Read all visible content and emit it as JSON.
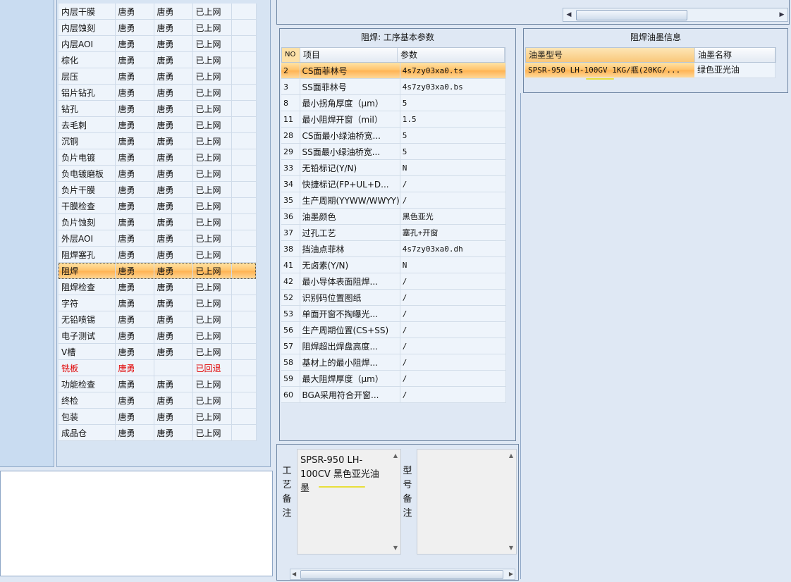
{
  "process_list": [
    {
      "name": "内层干膜",
      "col2": "唐勇",
      "col3": "唐勇",
      "status": "已上网",
      "state": "normal"
    },
    {
      "name": "内层蚀刻",
      "col2": "唐勇",
      "col3": "唐勇",
      "status": "已上网",
      "state": "normal"
    },
    {
      "name": "内层AOI",
      "col2": "唐勇",
      "col3": "唐勇",
      "status": "已上网",
      "state": "normal"
    },
    {
      "name": "棕化",
      "col2": "唐勇",
      "col3": "唐勇",
      "status": "已上网",
      "state": "normal"
    },
    {
      "name": "层压",
      "col2": "唐勇",
      "col3": "唐勇",
      "status": "已上网",
      "state": "normal"
    },
    {
      "name": "铝片钻孔",
      "col2": "唐勇",
      "col3": "唐勇",
      "status": "已上网",
      "state": "normal"
    },
    {
      "name": "钻孔",
      "col2": "唐勇",
      "col3": "唐勇",
      "status": "已上网",
      "state": "normal"
    },
    {
      "name": "去毛刺",
      "col2": "唐勇",
      "col3": "唐勇",
      "status": "已上网",
      "state": "normal"
    },
    {
      "name": "沉铜",
      "col2": "唐勇",
      "col3": "唐勇",
      "status": "已上网",
      "state": "normal"
    },
    {
      "name": "负片电镀",
      "col2": "唐勇",
      "col3": "唐勇",
      "status": "已上网",
      "state": "normal"
    },
    {
      "name": "负电镀磨板",
      "col2": "唐勇",
      "col3": "唐勇",
      "status": "已上网",
      "state": "normal"
    },
    {
      "name": "负片干膜",
      "col2": "唐勇",
      "col3": "唐勇",
      "status": "已上网",
      "state": "normal"
    },
    {
      "name": "干膜检查",
      "col2": "唐勇",
      "col3": "唐勇",
      "status": "已上网",
      "state": "normal"
    },
    {
      "name": "负片蚀刻",
      "col2": "唐勇",
      "col3": "唐勇",
      "status": "已上网",
      "state": "normal"
    },
    {
      "name": "外层AOI",
      "col2": "唐勇",
      "col3": "唐勇",
      "status": "已上网",
      "state": "normal"
    },
    {
      "name": "阻焊塞孔",
      "col2": "唐勇",
      "col3": "唐勇",
      "status": "已上网",
      "state": "normal"
    },
    {
      "name": "阻焊",
      "col2": "唐勇",
      "col3": "唐勇",
      "status": "已上网",
      "state": "selected"
    },
    {
      "name": "阻焊检查",
      "col2": "唐勇",
      "col3": "唐勇",
      "status": "已上网",
      "state": "normal"
    },
    {
      "name": "字符",
      "col2": "唐勇",
      "col3": "唐勇",
      "status": "已上网",
      "state": "normal"
    },
    {
      "name": "无铅喷锡",
      "col2": "唐勇",
      "col3": "唐勇",
      "status": "已上网",
      "state": "normal"
    },
    {
      "name": "电子测试",
      "col2": "唐勇",
      "col3": "唐勇",
      "status": "已上网",
      "state": "normal"
    },
    {
      "name": "V槽",
      "col2": "唐勇",
      "col3": "唐勇",
      "status": "已上网",
      "state": "normal"
    },
    {
      "name": "铣板",
      "col2": "唐勇",
      "col3": "",
      "status": "已回退",
      "state": "returned"
    },
    {
      "name": "功能检查",
      "col2": "唐勇",
      "col3": "唐勇",
      "status": "已上网",
      "state": "normal"
    },
    {
      "name": "终检",
      "col2": "唐勇",
      "col3": "唐勇",
      "status": "已上网",
      "state": "normal"
    },
    {
      "name": "包装",
      "col2": "唐勇",
      "col3": "唐勇",
      "status": "已上网",
      "state": "normal"
    },
    {
      "name": "成品仓",
      "col2": "唐勇",
      "col3": "唐勇",
      "status": "已上网",
      "state": "normal"
    }
  ],
  "params_panel": {
    "title": "阻焊: 工序基本参数",
    "headers": {
      "no": "NO",
      "item": "项目",
      "value": "参数"
    },
    "rows": [
      {
        "no": "2",
        "item": "CS面菲林号",
        "value": "4s7zy03xa0.ts",
        "selected": true
      },
      {
        "no": "3",
        "item": "SS面菲林号",
        "value": "4s7zy03xa0.bs"
      },
      {
        "no": "8",
        "item": "最小拐角厚度（μm）",
        "value": "5"
      },
      {
        "no": "11",
        "item": "最小阻焊开窗（mil）",
        "value": "1.5"
      },
      {
        "no": "28",
        "item": "CS面最小绿油桥宽...",
        "value": "5"
      },
      {
        "no": "29",
        "item": "SS面最小绿油桥宽...",
        "value": "5"
      },
      {
        "no": "33",
        "item": "无铅标记(Y/N)",
        "value": "N"
      },
      {
        "no": "34",
        "item": "快捷标记(FP+UL+D...",
        "value": "/"
      },
      {
        "no": "35",
        "item": "生产周期(YYWW/WWYY)",
        "value": "/"
      },
      {
        "no": "36",
        "item": "油墨颜色",
        "value": "黑色亚光"
      },
      {
        "no": "37",
        "item": "过孔工艺",
        "value": "塞孔+开窗"
      },
      {
        "no": "38",
        "item": "挡油点菲林",
        "value": "4s7zy03xa0.dh"
      },
      {
        "no": "41",
        "item": "无卤素(Y/N)",
        "value": "N"
      },
      {
        "no": "42",
        "item": "最小导体表面阻焊...",
        "value": "/"
      },
      {
        "no": "52",
        "item": "识别码位置图纸",
        "value": "/"
      },
      {
        "no": "53",
        "item": "单面开窗不掏曝光...",
        "value": "/"
      },
      {
        "no": "56",
        "item": "生产周期位置(CS+SS)",
        "value": "/"
      },
      {
        "no": "57",
        "item": "阻焊超出焊盘高度...",
        "value": "/"
      },
      {
        "no": "58",
        "item": "基材上的最小阻焊...",
        "value": "/"
      },
      {
        "no": "59",
        "item": "最大阻焊厚度（μm）",
        "value": "/"
      },
      {
        "no": "60",
        "item": "BGA采用符合开窗...",
        "value": "/"
      }
    ]
  },
  "ink_panel": {
    "title": "阻焊油墨信息",
    "headers": {
      "model": "油墨型号",
      "name": "油墨名称"
    },
    "rows": [
      {
        "model": "SPSR-950 LH-100GV 1KG/瓶(20KG/...",
        "name": "绿色亚光油"
      }
    ]
  },
  "remarks": {
    "process_label": "工艺备注",
    "process_text": "SPSR-950 LH-100CV 黑色亚光油墨",
    "model_label": "型号备注",
    "model_text": ""
  }
}
